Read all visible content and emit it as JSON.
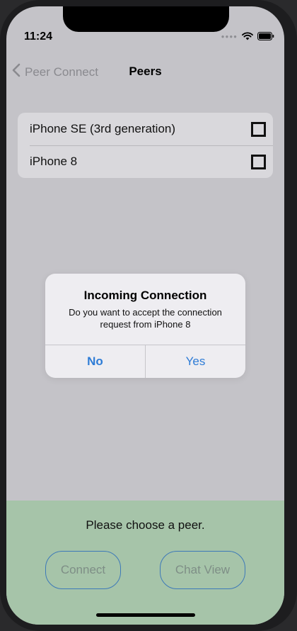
{
  "status_bar": {
    "time": "11:24",
    "icons": [
      "signal-dots-icon",
      "wifi-icon",
      "battery-icon"
    ]
  },
  "nav": {
    "back_label": "Peer Connect",
    "title": "Peers"
  },
  "peers": [
    {
      "name": "iPhone SE (3rd generation)",
      "checked": false
    },
    {
      "name": "iPhone 8",
      "checked": false
    }
  ],
  "alert": {
    "title": "Incoming Connection",
    "message": "Do you want to accept the connection request from iPhone 8",
    "no_label": "No",
    "yes_label": "Yes"
  },
  "bottom": {
    "prompt": "Please choose a peer.",
    "connect_label": "Connect",
    "chat_view_label": "Chat View"
  },
  "colors": {
    "background": "#c4c3c8",
    "bottom_panel": "#a6c4a9",
    "accent_blue": "#2e7cd6",
    "button_border": "#3d79b8"
  }
}
